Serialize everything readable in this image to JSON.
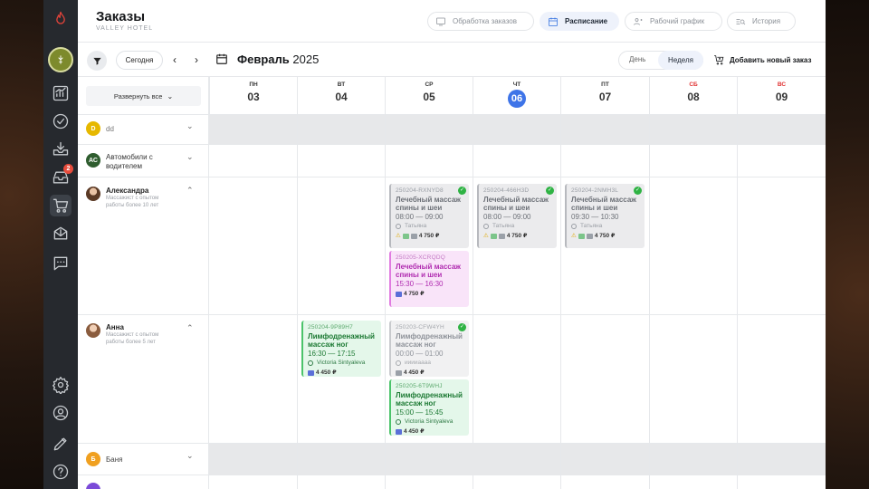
{
  "header": {
    "title": "Заказы",
    "subtitle": "VALLEY HOTEL"
  },
  "nav_tabs": [
    {
      "label": "Обработка заказов",
      "icon": "monitor-icon"
    },
    {
      "label": "Расписание",
      "icon": "calendar-icon",
      "active": true
    },
    {
      "label": "Рабочий график",
      "icon": "users-icon"
    },
    {
      "label": "История",
      "icon": "history-icon"
    }
  ],
  "rail": {
    "badge": "2"
  },
  "toolbar": {
    "today": "Сегодня",
    "prev": "‹",
    "next": "›",
    "month_name": "Февраль",
    "year": "2025",
    "view_day": "День",
    "view_week": "Неделя",
    "add_order": "Добавить новый заказ"
  },
  "expand_all": "Развернуть все",
  "days": [
    {
      "name": "ПН",
      "num": "03"
    },
    {
      "name": "ВТ",
      "num": "04"
    },
    {
      "name": "СР",
      "num": "05"
    },
    {
      "name": "ЧТ",
      "num": "06",
      "current": true
    },
    {
      "name": "ПТ",
      "num": "07"
    },
    {
      "name": "СБ",
      "num": "08",
      "weekend": true
    },
    {
      "name": "ВС",
      "num": "09",
      "weekend": true
    }
  ],
  "resources": [
    {
      "initials": "D",
      "name": "dd",
      "color": "#e6b800"
    },
    {
      "initials": "АС",
      "name": "Автомобили с водителем",
      "color": "#2f5d2f"
    },
    {
      "name": "Александра",
      "desc": "Массажист с опытом работы более 10 лет",
      "photo": true
    },
    {
      "name": "Анна",
      "desc": "Массажист с опытом работы более 5 лет",
      "photo": true
    },
    {
      "initials": "Б",
      "name": "Баня",
      "color": "#f0a020"
    }
  ],
  "events": [
    {
      "code": "250204-RXNYD8",
      "name": "Лечебный массаж спины и шеи",
      "time": "08:00 — 09:00",
      "person": "Татьяна",
      "price": "4 750 ₽",
      "status": "gray"
    },
    {
      "code": "250204-466H3D",
      "name": "Лечебный массаж спины и шеи",
      "time": "08:00 — 09:00",
      "person": "Татьяна",
      "price": "4 750 ₽",
      "status": "gray"
    },
    {
      "code": "250204-2NMH3L",
      "name": "Лечебный массаж спины и шеи",
      "time": "09:30 — 10:30",
      "person": "Татьяна",
      "price": "4 750 ₽",
      "status": "gray"
    },
    {
      "code": "250205-XCRQDQ",
      "name": "Лечебный массаж спины и шеи",
      "time": "15:30 — 16:30",
      "price": "4 750 ₽",
      "status": "pink"
    },
    {
      "code": "250204-9P89H7",
      "name": "Лимфодренажный массаж ног",
      "time": "16:30 — 17:15",
      "person": "Victoria Sintyaleva",
      "price": "4 450 ₽",
      "status": "green"
    },
    {
      "code": "250203-CFW4YH",
      "name": "Лимфодренажный массаж ног",
      "time": "00:00 — 01:00",
      "person": "ииииаааа",
      "price": "4 450 ₽",
      "status": "lgray"
    },
    {
      "code": "250205-6T9WHJ",
      "name": "Лимфодренажный массаж ног",
      "time": "15:00 — 15:45",
      "person": "Victoria Sintyaleva",
      "price": "4 450 ₽",
      "status": "green"
    }
  ]
}
